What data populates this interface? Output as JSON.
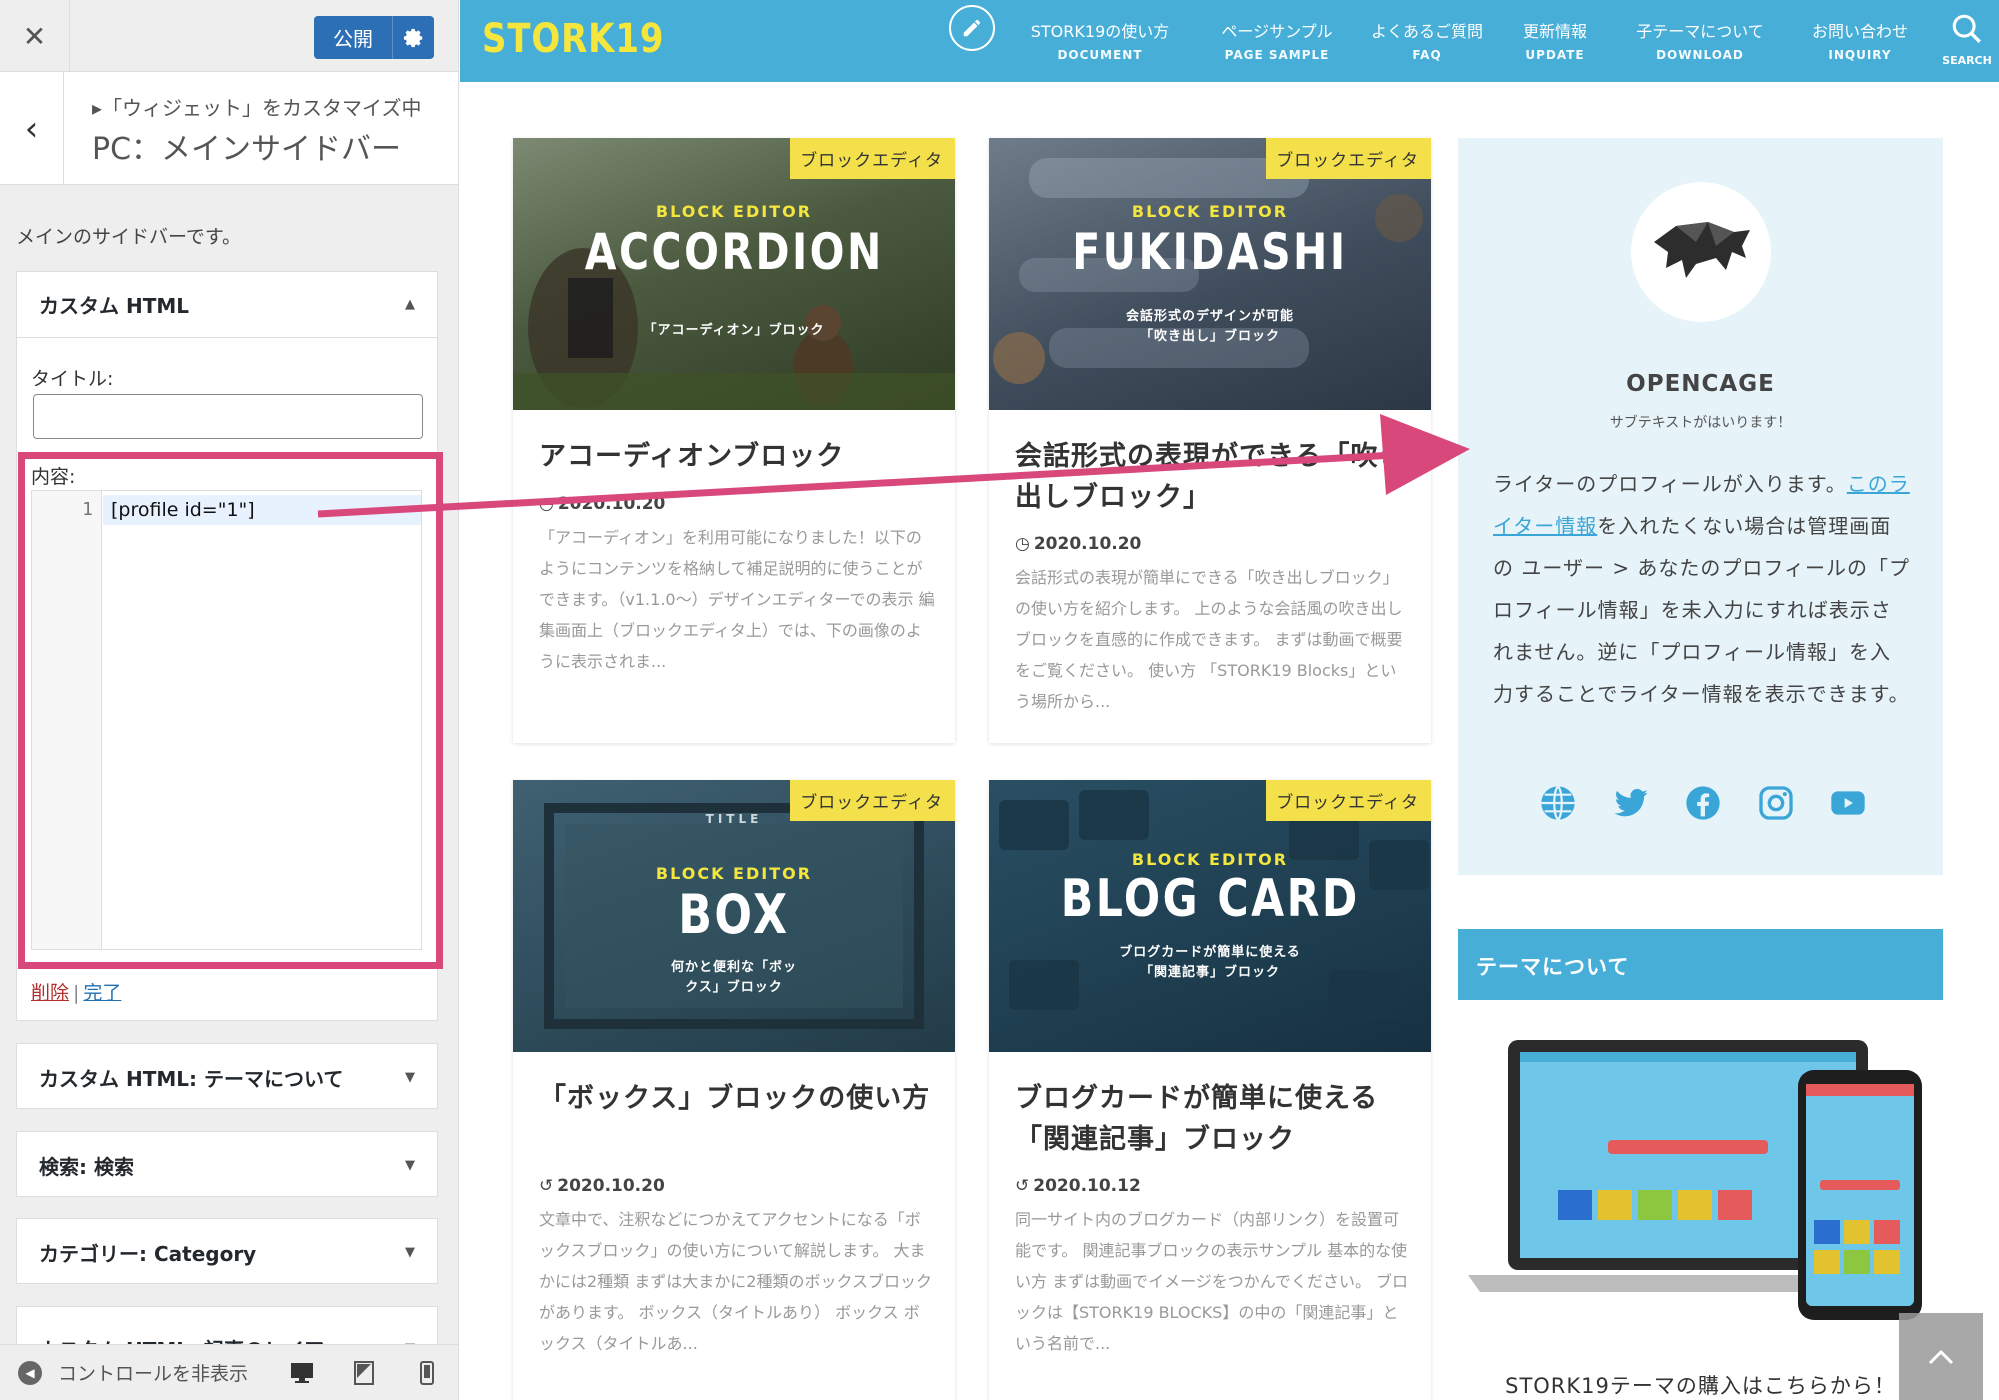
{
  "customizer": {
    "publish_label": "公開",
    "breadcrumb": "▸「ウィジェット」をカスタマイズ中",
    "title": "PC：メインサイドバー",
    "description": "メインのサイドバーです。",
    "widgets": [
      {
        "label": "カスタム HTML",
        "state": "▲"
      },
      {
        "label": "カスタム HTML: テーマについて",
        "state": "▼"
      },
      {
        "label": "検索: 検索",
        "state": "▼"
      },
      {
        "label": "カテゴリー: Category",
        "state": "▼"
      },
      {
        "label": "カスタム HTML: 記事のレイア",
        "state": "▼"
      }
    ],
    "title_field_label": "タイトル:",
    "content_field_label": "内容:",
    "line_number": "1",
    "code": "[profile id=\"1\"]",
    "delete_label": "削除",
    "separator": "|",
    "done_label": "完了",
    "hide_controls_label": "コントロールを非表示"
  },
  "site": {
    "logo": "STORK19",
    "nav": [
      {
        "jp": "STORK19の使い方",
        "en": "DOCUMENT"
      },
      {
        "jp": "ページサンプル",
        "en": "PAGE SAMPLE"
      },
      {
        "jp": "よくあるご質問",
        "en": "FAQ"
      },
      {
        "jp": "更新情報",
        "en": "UPDATE"
      },
      {
        "jp": "子テーマについて",
        "en": "DOWNLOAD"
      },
      {
        "jp": "お問い合わせ",
        "en": "INQUIRY"
      }
    ],
    "search_label": "SEARCH",
    "cards": [
      {
        "tag": "ブロックエディタ",
        "be": "BLOCK EDITOR",
        "big": "ACCORDION",
        "sub": "「アコーディオン」ブロック",
        "title": "アコーディオンブロック",
        "date": "2020.10.20",
        "excerpt": "「アコーディオン」を利用可能になりました！以下のようにコンテンツを格納して補足説明的に使うことができます。（v1.1.0〜）デザインエディターでの表示 編集画面上（ブロックエディタ上）では、下の画像のように表示されま..."
      },
      {
        "tag": "ブロックエディタ",
        "be": "BLOCK EDITOR",
        "big": "FUKIDASHI",
        "sub": "会話形式のデザインが可能「吹き出し」ブロック",
        "title": "会話形式の表現ができる「吹き出しブロック」",
        "date": "2020.10.20",
        "excerpt": "会話形式の表現が簡単にできる「吹き出しブロック」の使い方を紹介します。 上のような会話風の吹き出しブロックを直感的に作成できます。 まずは動画で概要をご覧ください。 使い方 「STORK19 Blocks」という場所から..."
      },
      {
        "tag": "ブロックエディタ",
        "be": "BLOCK EDITOR",
        "big": "BOX",
        "pre": "TITLE",
        "sub": "何かと便利な「ボックス」ブロック",
        "title": "「ボックス」ブロックの使い方",
        "date": "2020.10.20",
        "excerpt": "文章中で、注釈などにつかえてアクセントになる「ボックスブロック」の使い方について解説します。 大まかには2種類 まずは大まかに2種類のボックスブロックがあります。 ボックス（タイトルあり） ボックス ボックス（タイトルあ..."
      },
      {
        "tag": "ブロックエディタ",
        "be": "BLOCK EDITOR",
        "big": "BLOG CARD",
        "sub": "ブログカードが簡単に使える「関連記事」ブロック",
        "title": "ブログカードが簡単に使える「関連記事」ブロック",
        "date": "2020.10.12",
        "excerpt": "同一サイト内のブログカード（内部リンク）を設置可能です。 関連記事ブロックの表示サンプル 基本的な使い方 まずは動画でイメージをつかんでください。 ブロックは【STORK19 BLOCKS】の中の「関連記事」という名前で..."
      }
    ],
    "profile": {
      "name": "OPENCAGE",
      "subtext": "サブテキストがはいります！",
      "body_before": "ライターのプロフィールが入ります。",
      "body_link": "このライター情報",
      "body_after": "を入れたくない場合は管理画面の ユーザー > あなたのプロフィールの「プロフィール情報」を未入力にすれば表示されません。逆に「プロフィール情報」を入力することでライター情報を表示できます。"
    },
    "theme_heading": "テーマについて",
    "buy_text": "STORK19テーマの購入はこちらから！"
  },
  "colors": {
    "accent": "#47aed8",
    "logo": "#f5e63e",
    "tag": "#f3e04b",
    "highlight": "#d9487b",
    "publish": "#2c6fb4"
  }
}
